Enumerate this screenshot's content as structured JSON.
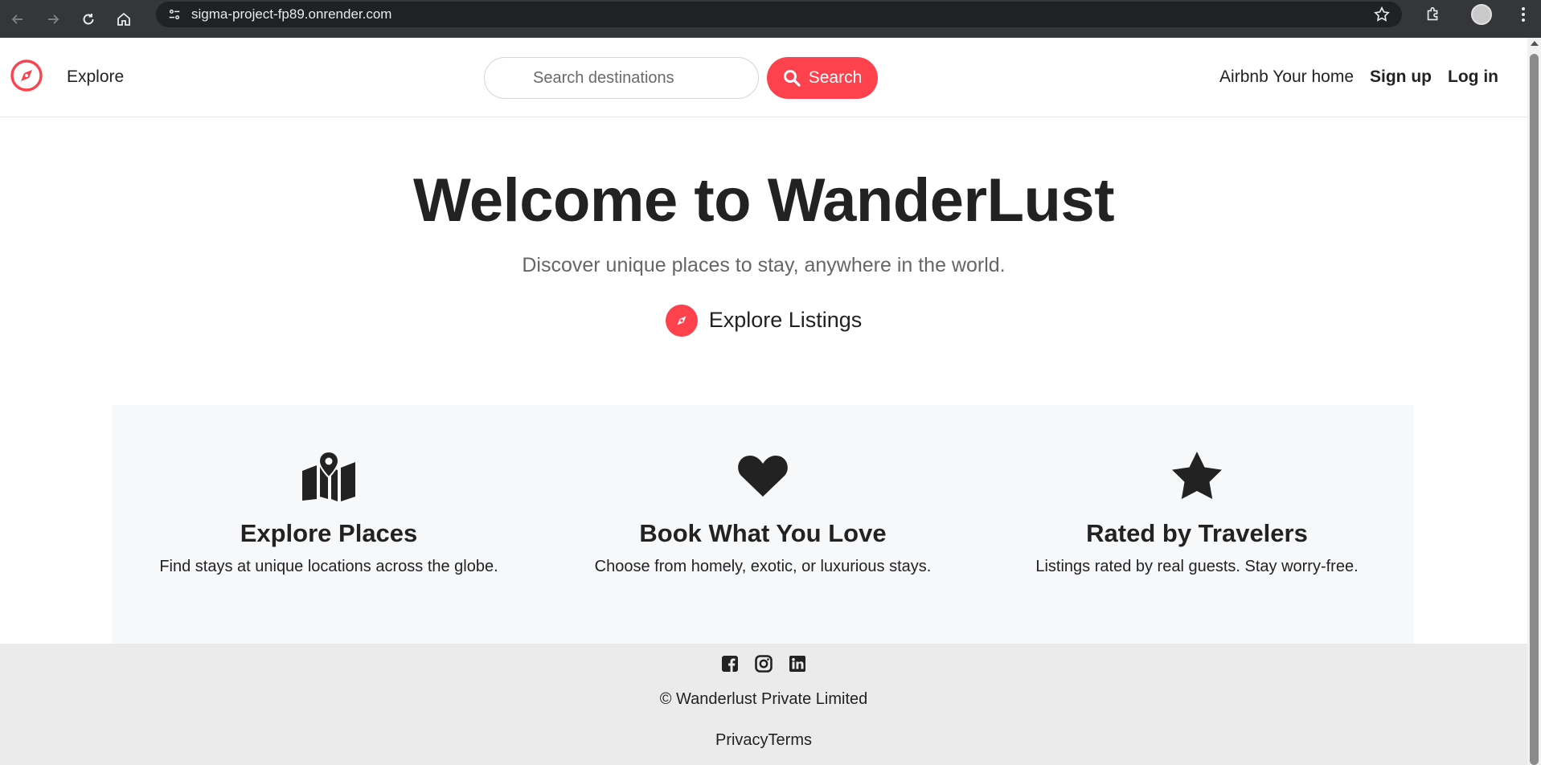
{
  "browser": {
    "url": "sigma-project-fp89.onrender.com"
  },
  "navbar": {
    "explore_label": "Explore",
    "search_placeholder": "Search destinations",
    "search_button_label": "Search",
    "host_label": "Airbnb Your home",
    "signup_label": "Sign up",
    "login_label": "Log in"
  },
  "hero": {
    "title": "Welcome to WanderLust",
    "subtitle": "Discover unique places to stay, anywhere in the world.",
    "cta_label": "Explore Listings"
  },
  "features": [
    {
      "icon": "map-location-icon",
      "title": "Explore Places",
      "text": "Find stays at unique locations across the globe."
    },
    {
      "icon": "heart-icon",
      "title": "Book What You Love",
      "text": "Choose from homely, exotic, or luxurious stays."
    },
    {
      "icon": "star-icon",
      "title": "Rated by Travelers",
      "text": "Listings rated by real guests. Stay worry-free."
    }
  ],
  "footer": {
    "copyright": "© Wanderlust Private Limited",
    "policies": "PrivacyTerms"
  },
  "colors": {
    "brand": "#fe424d",
    "chrome_bg": "#35363a",
    "footer_bg": "#ebebeb",
    "feature_bg": "#f7f8fa"
  }
}
